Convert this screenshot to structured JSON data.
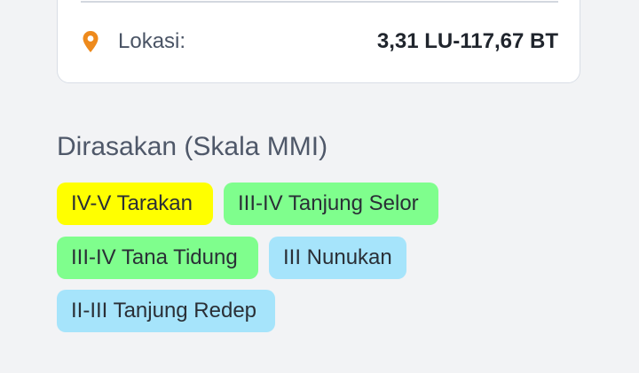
{
  "location": {
    "icon": "map-pin-icon",
    "icon_color": "#ee8a1c",
    "label": "Lokasi:",
    "value": "3,31 LU-117,67 BT"
  },
  "felt": {
    "title": "Dirasakan (Skala MMI)",
    "chips": [
      {
        "text": "IV-V Tarakan",
        "color": "#ffff00"
      },
      {
        "text": "III-IV Tanjung Selor",
        "color": "#7ffe8d"
      },
      {
        "text": "III-IV Tana Tidung",
        "color": "#7ffe8d"
      },
      {
        "text": "III Nunukan",
        "color": "#a6e4fb"
      },
      {
        "text": "II-III Tanjung Redep",
        "color": "#a6e4fb"
      }
    ]
  }
}
